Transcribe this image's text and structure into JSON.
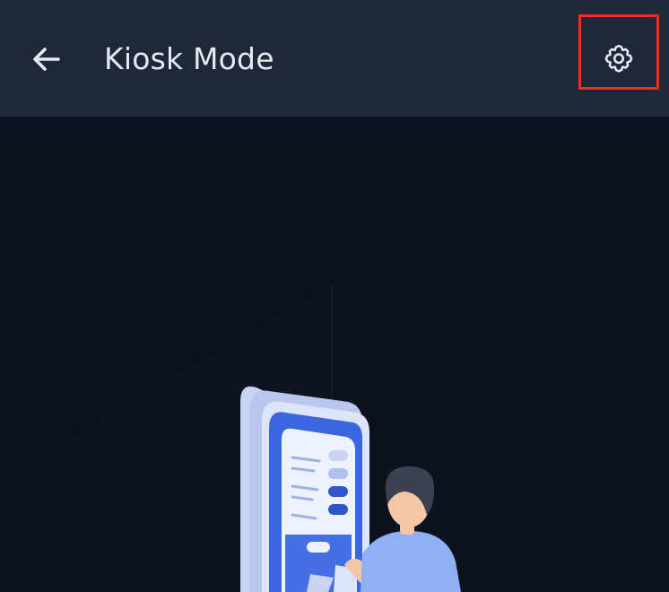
{
  "app_bar": {
    "title": "Kiosk Mode",
    "back_icon": "arrow-left-icon",
    "settings_icon": "gear-icon"
  },
  "colors": {
    "app_bar_bg": "#1f2839",
    "content_bg": "#0b111d",
    "highlight": "#e8321d",
    "accent": "#3b66e0",
    "text": "#e6e9ef"
  },
  "illustration": {
    "name": "kiosk-person-illustration"
  }
}
